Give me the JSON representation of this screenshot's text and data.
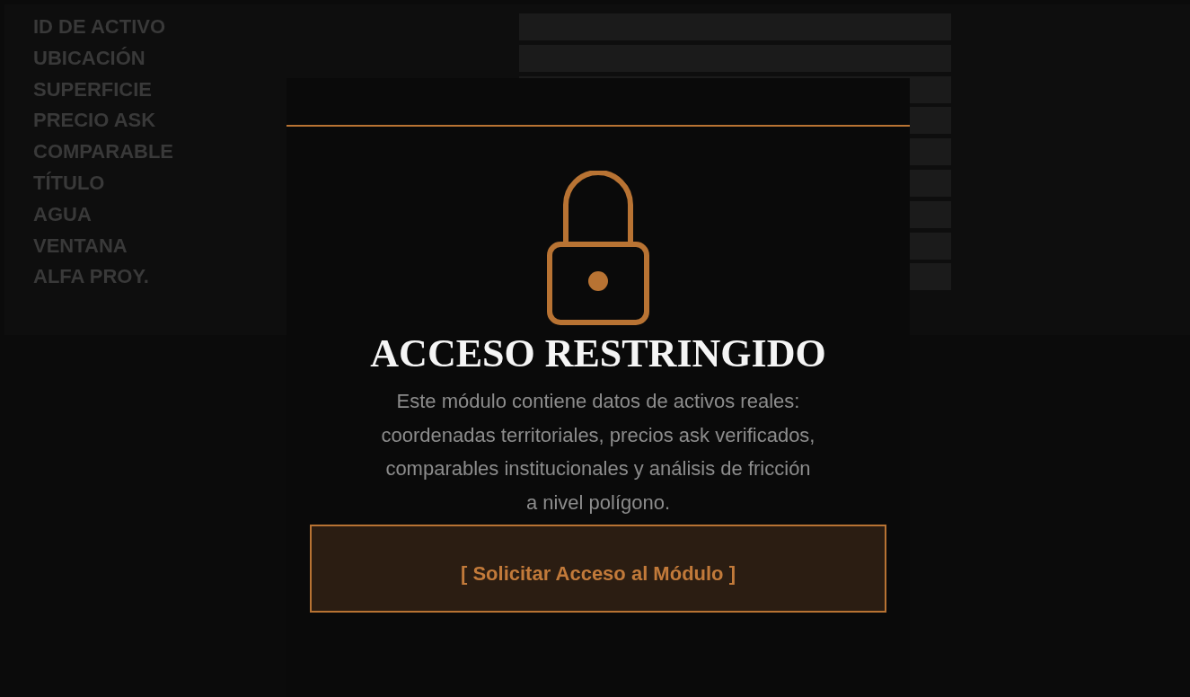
{
  "form": {
    "rows": [
      {
        "label": "ID DE ACTIVO"
      },
      {
        "label": "UBICACIÓN"
      },
      {
        "label": "SUPERFICIE"
      },
      {
        "label": "PRECIO ASK"
      },
      {
        "label": "COMPARABLE"
      },
      {
        "label": "TÍTULO"
      },
      {
        "label": "AGUA"
      },
      {
        "label": "VENTANA"
      },
      {
        "label": "ALFA PROY."
      }
    ]
  },
  "overlay": {
    "title": "ACCESO RESTRINGIDO",
    "lines": [
      "Este módulo contiene datos de activos reales:",
      "coordenadas territoriales, precios ask verificados,",
      "comparables institucionales y análisis de fricción",
      "a nivel polígono."
    ],
    "button": "[ Solicitar Acceso al Módulo ]"
  }
}
